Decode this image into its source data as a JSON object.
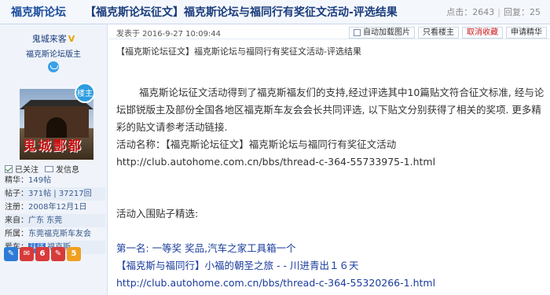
{
  "header": {
    "forum_name": "福克斯论坛",
    "thread_title": "【福克斯论坛征文】福克斯论坛与福同行有奖征文活动-评选结果",
    "clicks_label": "点击：2643",
    "replies_label": "回复：25"
  },
  "author": {
    "name": "鬼城来客",
    "verified_mark": "V",
    "role": "福克斯论坛版主",
    "avatar_text": "鬼城酆都",
    "host_badge": "楼主",
    "follow_label": "已关注",
    "message_label": "发信息",
    "info": [
      {
        "k": "精华：",
        "v": "149帖"
      },
      {
        "k": "帖子：",
        "v": "371帖 | 37217回"
      },
      {
        "k": "注册：",
        "v": "2008年12月1日"
      },
      {
        "k": "来自：",
        "v": "广东 东莞"
      },
      {
        "k": "所属：",
        "v": "东莞福克斯车友会"
      },
      {
        "k": "爱车：",
        "cert": "认证",
        "v": "福克斯"
      }
    ],
    "medals": [
      {
        "label": "✎",
        "color": "#2d7bd6"
      },
      {
        "label": "✉",
        "color": "#d83a3a"
      },
      {
        "label": "6",
        "color": "#d83a3a"
      },
      {
        "label": "✎",
        "color": "#d83a3a"
      },
      {
        "label": "5",
        "color": "#f0a020"
      }
    ]
  },
  "toolbar": {
    "posted": "发表于 2016-9-27 10:09:44",
    "auto_load_label": "自动加载图片",
    "only_host_label": "只看楼主",
    "cancel_fav_label": "取消收藏",
    "apply_digest_label": "申请精华"
  },
  "post": {
    "quote_line": "【福克斯论坛征文】福克斯论坛与福同行有奖征文活动-评选结果",
    "p1": "福克斯论坛征文活动得到了福克斯福友们的支持,经过评选其中10篇贴文符合征文标准, 经与论坛邯锐版主及部份全国各地区福克斯车友会会长共同评选, 以下贴文分别获得了相关的奖项. 更多精彩的贴文请参考活动链接.",
    "p2": "活动名称：【福克斯论坛征文】福克斯论坛与福同行有奖征文活动http://club.autohome.com.cn/bbs/thread-c-364-55733975-1.html",
    "p3": "活动入围贴子精选:",
    "p4": "第一名:  一等奖      奖品,汽车之家工具箱一个",
    "p5": "【福克斯与福同行】小福的朝圣之旅 - - 川进青出１６天 http://club.autohome.com.cn/bbs/thread-c-364-55320266-1.html"
  }
}
